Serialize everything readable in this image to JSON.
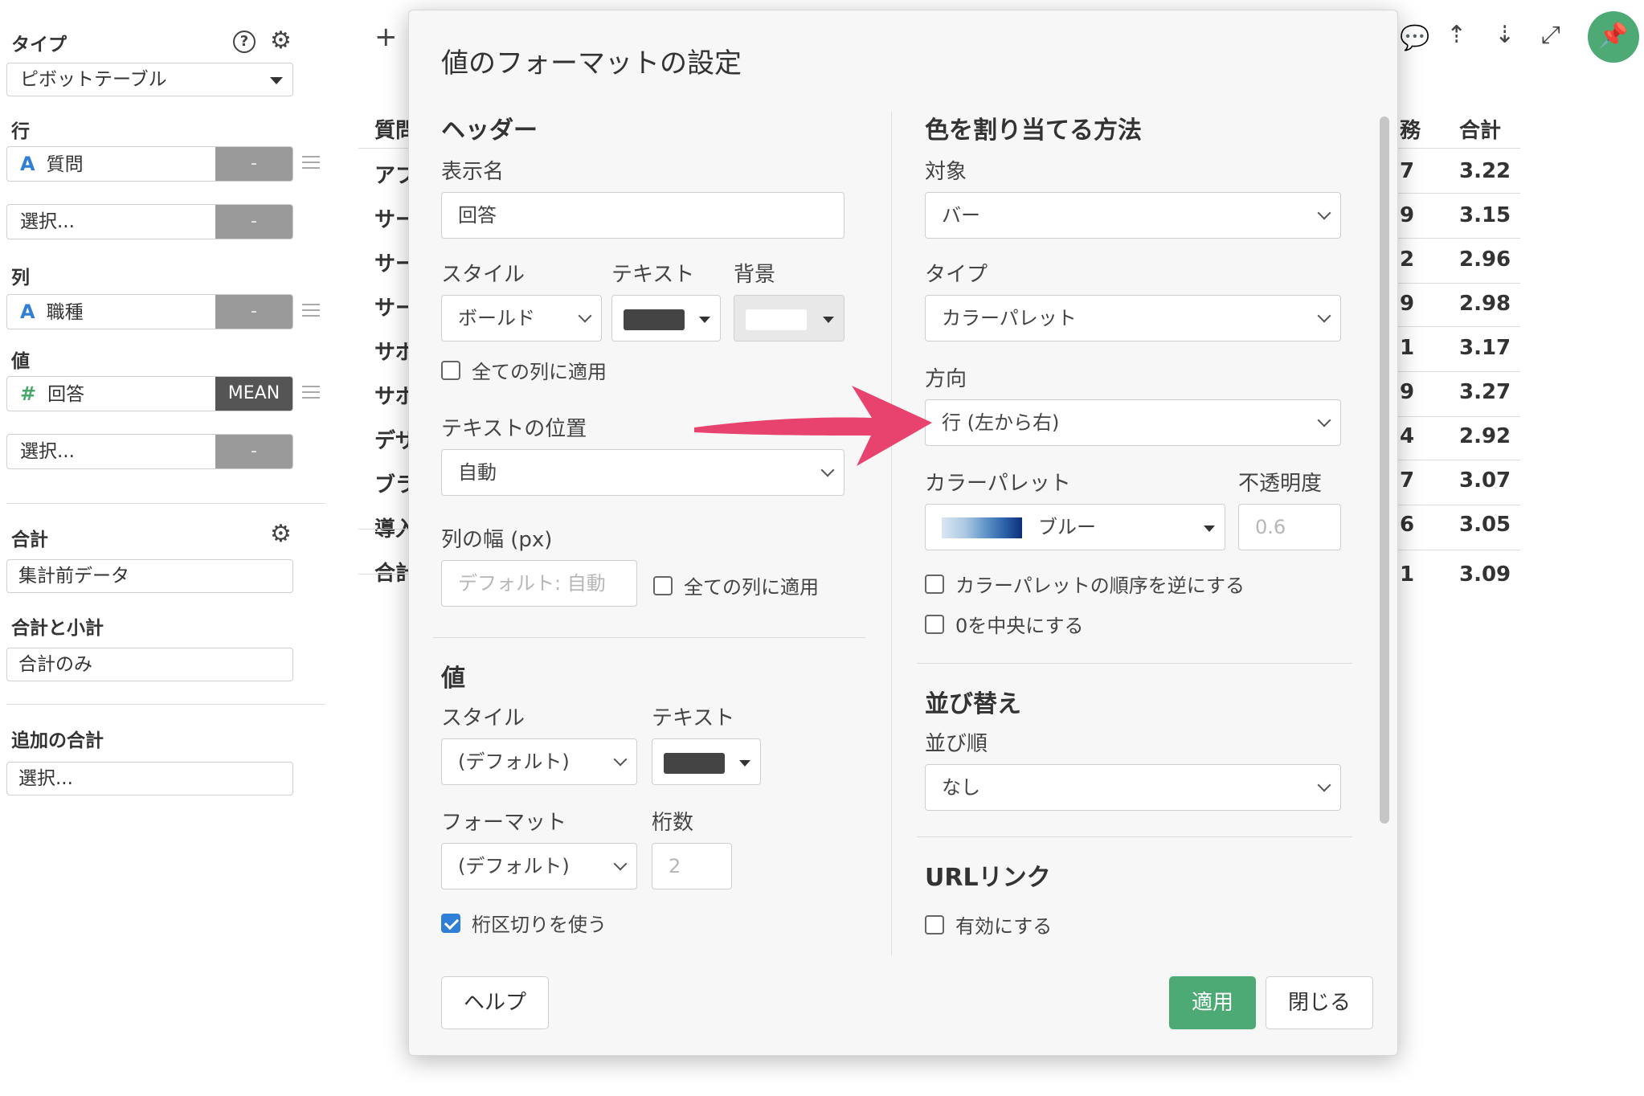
{
  "sidebar": {
    "type_label": "タイプ",
    "type_value": "ピボットテーブル",
    "row_label": "行",
    "row_field": {
      "type_icon": "A",
      "name": "質問",
      "button": "-"
    },
    "row_select": {
      "placeholder": "選択...",
      "button": "-"
    },
    "col_label": "列",
    "col_field": {
      "type_icon": "A",
      "name": "職種",
      "button": "-"
    },
    "val_label": "値",
    "val_field": {
      "type_icon": "#",
      "name": "回答",
      "button": "MEAN"
    },
    "val_select": {
      "placeholder": "選択...",
      "button": "-"
    },
    "total_label": "合計",
    "total_value": "集計前データ",
    "subtotal_label": "合計と小計",
    "subtotal_value": "合計のみ",
    "extra_total_label": "追加の合計",
    "extra_total_value": "選択..."
  },
  "bg_table": {
    "plus": "+",
    "left_col": [
      "質問",
      "アプ",
      "サー",
      "サー",
      "サー",
      "サポ",
      "サポ",
      "デザ",
      "ブラ",
      "導入",
      "合計"
    ],
    "partial_col": [
      "7",
      "9",
      "2",
      "9",
      "1",
      "9",
      "4",
      "7",
      "6",
      "1"
    ],
    "total_header": "合計",
    "total_col": [
      "3.22",
      "3.15",
      "2.96",
      "2.98",
      "3.17",
      "3.27",
      "2.92",
      "3.07",
      "3.05",
      "3.09"
    ],
    "partial_header": "務"
  },
  "modal": {
    "title": "値のフォーマットの設定",
    "header_section": "ヘッダー",
    "display_name_label": "表示名",
    "display_name_value": "回答",
    "style_label": "スタイル",
    "style_value": "ボールド",
    "text_label": "テキスト",
    "bg_label": "背景",
    "apply_all_cols": "全ての列に適用",
    "text_pos_label": "テキストの位置",
    "text_pos_value": "自動",
    "col_width_label": "列の幅 (px)",
    "col_width_placeholder": "デフォルト: 自動",
    "apply_all_cols_2": "全ての列に適用",
    "value_section": "値",
    "v_style_label": "スタイル",
    "v_style_value": "(デフォルト)",
    "v_text_label": "テキスト",
    "format_label": "フォーマット",
    "format_value": "(デフォルト)",
    "digits_label": "桁数",
    "digits_placeholder": "2",
    "thousands_sep": "桁区切りを使う",
    "color_section": "色を割り当てる方法",
    "target_label": "対象",
    "target_value": "バー",
    "type_label": "タイプ",
    "type_value": "カラーパレット",
    "direction_label": "方向",
    "direction_value": "行 (左から右)",
    "palette_label": "カラーパレット",
    "palette_value": "ブルー",
    "opacity_label": "不透明度",
    "opacity_placeholder": "0.6",
    "reverse_palette": "カラーパレットの順序を逆にする",
    "center_zero": "0を中央にする",
    "sort_section": "並び替え",
    "sort_order_label": "並び順",
    "sort_order_value": "なし",
    "url_section": "URLリンク",
    "enable_url": "有効にする",
    "help_button": "ヘルプ",
    "apply_button": "適用",
    "close_button": "閉じる"
  },
  "colors": {
    "accent_green": "#4eaa74",
    "checkbox_blue": "#2f7fd6",
    "arrow": "#e8436e",
    "text_swatch": "#444444",
    "bg_swatch": "#ffffff"
  }
}
